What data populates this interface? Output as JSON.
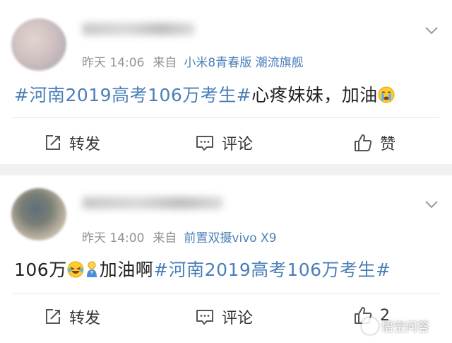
{
  "posts": [
    {
      "time": "昨天 14:06",
      "from_label": "来自",
      "source": "小米8青春版 潮流旗舰",
      "hashtag": "#河南2019高考106万考生#",
      "text": "心疼妹妹，加油",
      "emoji": "crying-face-icon",
      "actions": {
        "repost": "转发",
        "comment": "评论",
        "like": "赞"
      }
    },
    {
      "time": "昨天 14:00",
      "from_label": "来自",
      "source": "前置双摄vivo X9",
      "prefix": "106万",
      "text": "加油啊",
      "hashtag": "#河南2019高考106万考生#",
      "emojis": [
        "laughing-tears-icon",
        "praying-figure-icon"
      ],
      "actions": {
        "repost": "转发",
        "comment": "评论",
        "like": "2"
      }
    }
  ],
  "watermark": "悟空问答",
  "colors": {
    "link": "#4a7fb8",
    "meta": "#939393",
    "text": "#222222",
    "page_bg": "#f1f1f1"
  }
}
